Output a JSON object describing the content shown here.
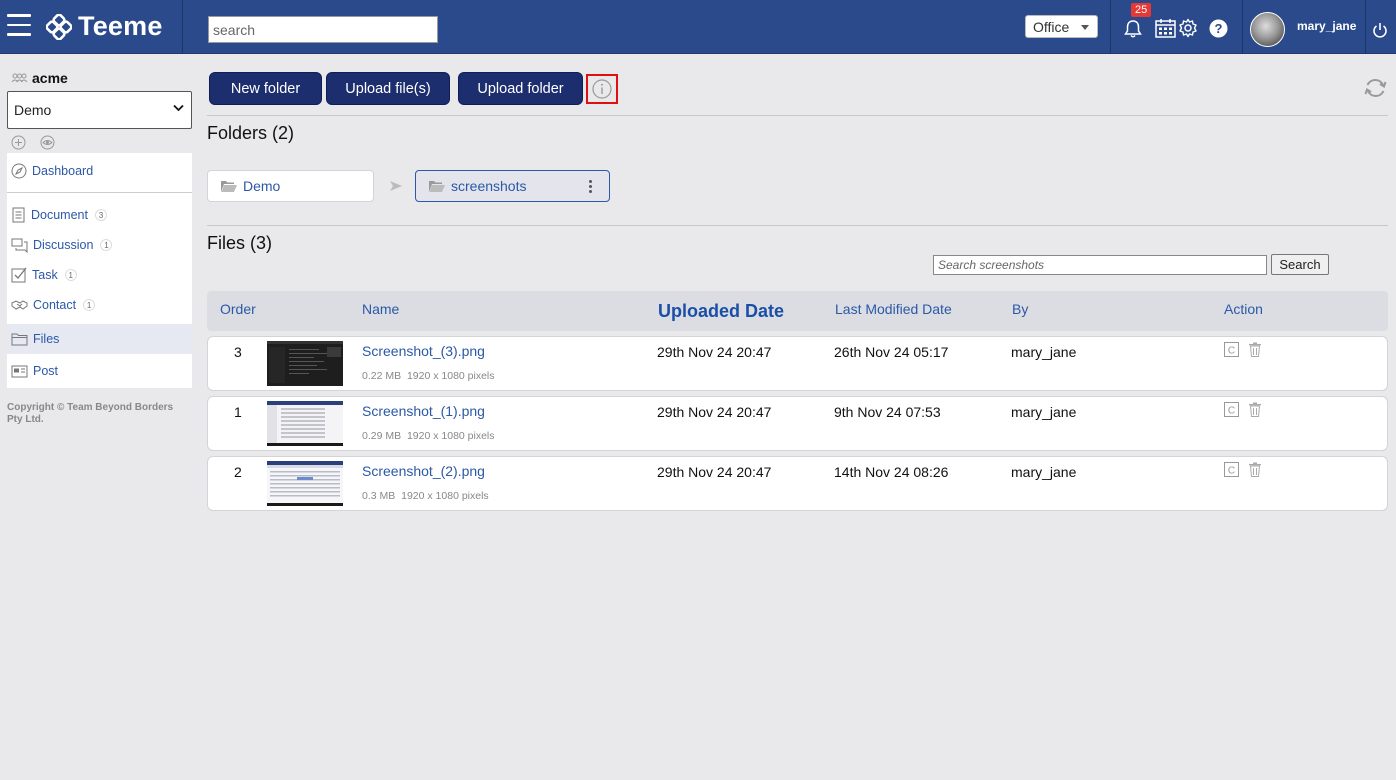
{
  "header": {
    "app_name": "Teeme",
    "search_placeholder": "search",
    "office_label": "Office",
    "notification_count": "25",
    "username": "mary_jane"
  },
  "sidebar": {
    "org_name": "acme",
    "workspace": "Demo",
    "items": [
      {
        "label": "Dashboard",
        "icon": "compass-icon"
      },
      {
        "label": "Document",
        "count": "3",
        "icon": "document-icon"
      },
      {
        "label": "Discussion",
        "count": "1",
        "icon": "discussion-icon"
      },
      {
        "label": "Task",
        "count": "1",
        "icon": "task-checkbox-icon"
      },
      {
        "label": "Contact",
        "count": "1",
        "icon": "handshake-icon"
      },
      {
        "label": "Files",
        "icon": "folder-icon"
      },
      {
        "label": "Post",
        "icon": "post-icon"
      }
    ],
    "copyright": "Copyright © Team Beyond Borders Pty Ltd."
  },
  "toolbar": {
    "new_folder": "New folder",
    "upload_files": "Upload file(s)",
    "upload_folder": "Upload folder"
  },
  "folders": {
    "title": "Folders (2)",
    "path": [
      "Demo",
      "screenshots"
    ]
  },
  "files": {
    "title": "Files (3)",
    "search_placeholder": "Search screenshots",
    "search_button": "Search",
    "columns": {
      "order": "Order",
      "name": "Name",
      "uploaded": "Uploaded Date",
      "modified": "Last Modified Date",
      "by": "By",
      "action": "Action"
    },
    "rows": [
      {
        "order": "3",
        "name": "Screenshot_(3).png",
        "size": "0.22 MB",
        "dims": "1920 x 1080 pixels",
        "uploaded": "29th Nov 24 20:47",
        "modified": "26th Nov 24 05:17",
        "by": "mary_jane"
      },
      {
        "order": "1",
        "name": "Screenshot_(1).png",
        "size": "0.29 MB",
        "dims": "1920 x 1080 pixels",
        "uploaded": "29th Nov 24 20:47",
        "modified": "9th Nov 24 07:53",
        "by": "mary_jane"
      },
      {
        "order": "2",
        "name": "Screenshot_(2).png",
        "size": "0.3 MB",
        "dims": "1920 x 1080 pixels",
        "uploaded": "29th Nov 24 20:47",
        "modified": "14th Nov 24 08:26",
        "by": "mary_jane"
      }
    ]
  },
  "colors": {
    "topbar": "#2b4a8b",
    "button": "#1c2e6e",
    "link": "#2b58a7",
    "highlight_border": "#e01010"
  }
}
